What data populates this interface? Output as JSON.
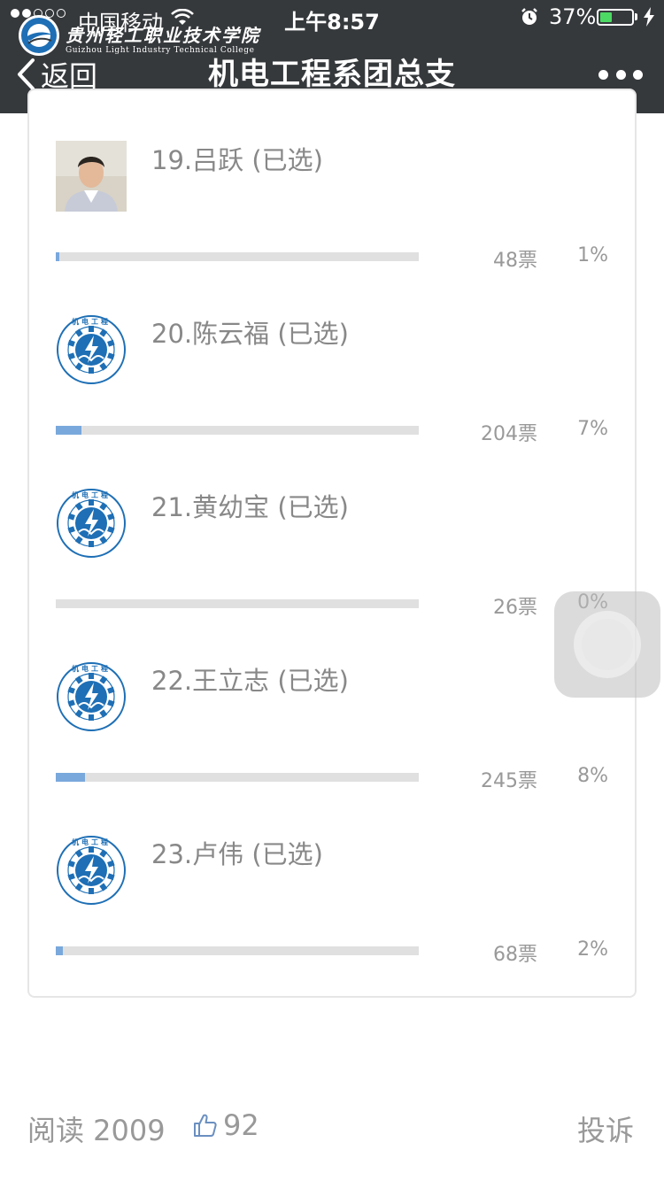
{
  "status_bar": {
    "carrier": "中国移动",
    "time": "上午8:57",
    "battery_percent": "37%",
    "battery_level": 0.37
  },
  "school_logo": {
    "name_cn": "贵州轻工职业技术学院",
    "name_en": "Guizhou Light Industry Technical College"
  },
  "nav": {
    "back_label": "返回",
    "title": "机电工程系团总支"
  },
  "candidates": [
    {
      "label": "19.吕跃 (已选)",
      "votes": "48票",
      "percent_label": "1%",
      "fraction": 0.01,
      "avatar": "photo"
    },
    {
      "label": "20.陈云福 (已选)",
      "votes": "204票",
      "percent_label": "7%",
      "fraction": 0.07,
      "avatar": "dept-logo"
    },
    {
      "label": "21.黄幼宝 (已选)",
      "votes": "26票",
      "percent_label": "0%",
      "fraction": 0.0,
      "avatar": "dept-logo"
    },
    {
      "label": "22.王立志 (已选)",
      "votes": "245票",
      "percent_label": "8%",
      "fraction": 0.08,
      "avatar": "dept-logo"
    },
    {
      "label": "23.卢伟 (已选)",
      "votes": "68票",
      "percent_label": "2%",
      "fraction": 0.02,
      "avatar": "dept-logo"
    }
  ],
  "dept_logo": {
    "top_text": "机电工程",
    "ring_text": "Mechanical and Electrical"
  },
  "footer": {
    "read_label": "阅读 2009",
    "like_count": "92",
    "report_label": "投诉"
  },
  "colors": {
    "topbar": "#36393c",
    "bar_fill": "#79a8dc",
    "bar_track": "#e0e0e0",
    "logo_blue": "#1e6fb5"
  }
}
